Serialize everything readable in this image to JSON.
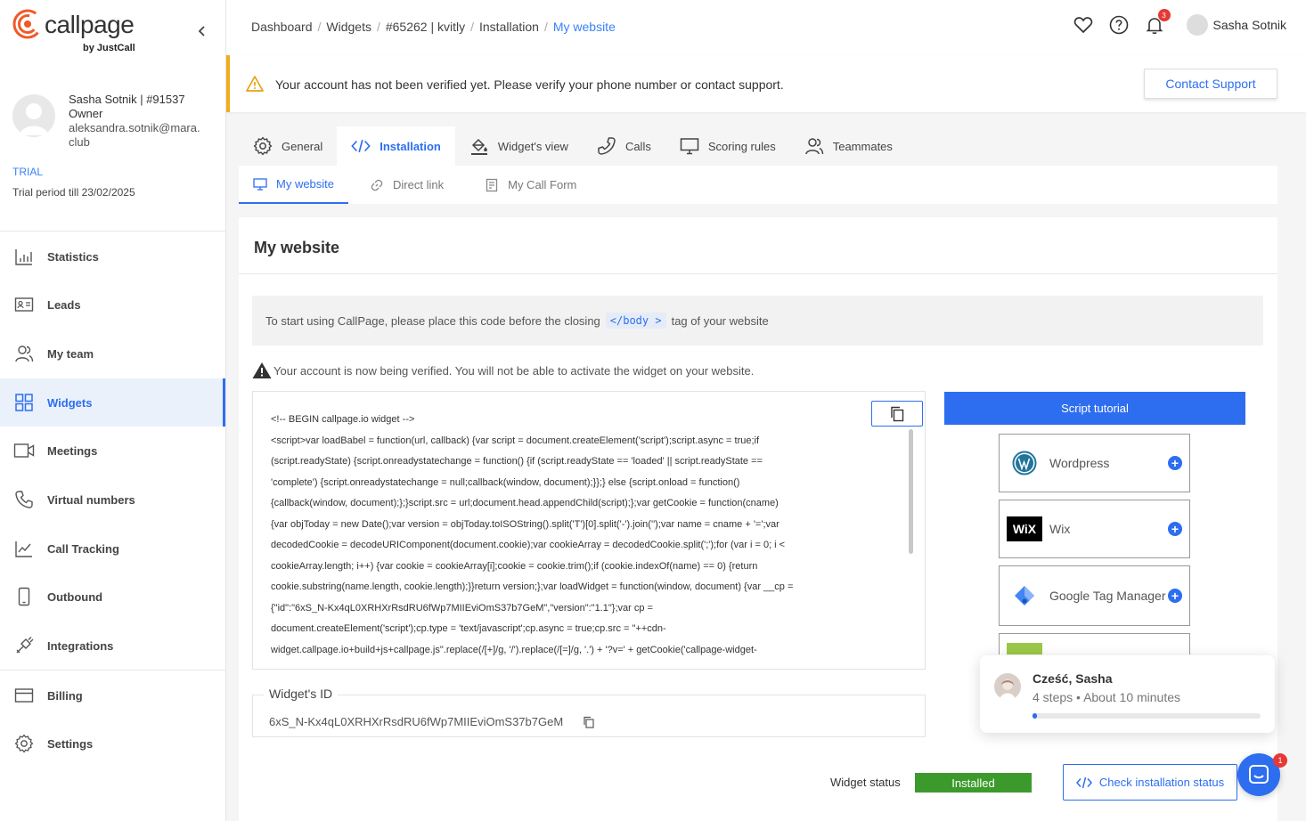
{
  "brand": {
    "name": "callpage",
    "tagline": "by JustCall",
    "accent": "#2d6ef0"
  },
  "profile": {
    "name": "Sasha Sotnik | #91537",
    "role": "Owner",
    "email": "aleksandra.sotnik@mara.club",
    "plan": "TRIAL",
    "trial": "Trial period till 23/02/2025"
  },
  "nav": [
    {
      "label": "Statistics",
      "icon": "bar-chart-icon"
    },
    {
      "label": "Leads",
      "icon": "id-card-icon"
    },
    {
      "label": "My team",
      "icon": "team-icon"
    },
    {
      "label": "Widgets",
      "icon": "grid-icon",
      "active": true
    },
    {
      "label": "Meetings",
      "icon": "video-icon"
    },
    {
      "label": "Virtual numbers",
      "icon": "phone-icon"
    },
    {
      "label": "Call Tracking",
      "icon": "trend-icon"
    },
    {
      "label": "Outbound",
      "icon": "mobile-icon"
    },
    {
      "label": "Integrations",
      "icon": "plug-icon"
    },
    {
      "label": "Billing",
      "icon": "card-icon"
    },
    {
      "label": "Settings",
      "icon": "gear-icon"
    }
  ],
  "breadcrumb": [
    "Dashboard",
    "Widgets",
    "#65262 | kvitly",
    "Installation",
    "My website"
  ],
  "topbar": {
    "user": "Sasha Sotnik",
    "notifications": "3"
  },
  "banner": {
    "text": "Your account has not been verified yet. Please verify your phone number or contact support.",
    "button": "Contact Support"
  },
  "tabs": [
    {
      "label": "General",
      "icon": "gear-icon"
    },
    {
      "label": "Installation",
      "icon": "code-icon",
      "active": true
    },
    {
      "label": "Widget's view",
      "icon": "paint-bucket-icon"
    },
    {
      "label": "Calls",
      "icon": "phone-icon"
    },
    {
      "label": "Scoring rules",
      "icon": "monitor-icon"
    },
    {
      "label": "Teammates",
      "icon": "teammates-icon"
    }
  ],
  "subtabs": [
    {
      "label": "My website",
      "icon": "monitor-icon",
      "active": true
    },
    {
      "label": "Direct link",
      "icon": "link-icon"
    },
    {
      "label": "My Call Form",
      "icon": "form-icon"
    }
  ],
  "main": {
    "title": "My website",
    "info_before": "To start using CallPage, please place this code before the closing",
    "info_tag": "</body >",
    "info_after": "tag of your website",
    "verify_note": "Your account is now being verified. You will not be able to activate the widget on your website.",
    "code_lines": [
      "<!-- BEGIN callpage.io widget -->",
      "<script>var loadBabel = function(url, callback) {var script = document.createElement('script');script.async = true;if",
      "(script.readyState) {script.onreadystatechange = function() {if (script.readyState == 'loaded' || script.readyState ==",
      "'complete') {script.onreadystatechange = null;callback(window, document);}};} else {script.onload = function()",
      "{callback(window, document);};}script.src = url;document.head.appendChild(script);};var getCookie = function(cname)",
      "{var objToday = new Date();var version = objToday.toISOString().split('T')[0].split('-').join('');var name = cname + '=';var",
      "decodedCookie = decodeURIComponent(document.cookie);var cookieArray = decodedCookie.split(';');for (var i = 0; i <",
      "cookieArray.length; i++) {var cookie = cookieArray[i];cookie = cookie.trim();if (cookie.indexOf(name) == 0) {return",
      "cookie.substring(name.length, cookie.length);}}return version;};var loadWidget = function(window, document) {var __cp =",
      "{\"id\":\"6xS_N-Kx4qL0XRHXrRsdRU6fWp7MIIEviOmS37b7GeM\",\"version\":\"1.1\"};var cp =",
      "document.createElement('script');cp.type = 'text/javascript';cp.async = true;cp.src = \"++cdn-",
      "widget.callpage.io+build+js+callpage.js\".replace(/[+]/g, '/').replace(/[=]/g, '.') + '?v=' + getCookie('callpage-widget-"
    ],
    "widget_id_label": "Widget's ID",
    "widget_id": "6xS_N-Kx4qL0XRHXrRsdRU6fWp7MIIEviOmS37b7GeM",
    "tutorial_button": "Script tutorial",
    "integrations": [
      {
        "name": "Wordpress",
        "icon": "wordpress-icon"
      },
      {
        "name": "Wix",
        "icon": "wix-icon"
      },
      {
        "name": "Google Tag Manager",
        "icon": "google-tag-manager-icon"
      }
    ],
    "status_label": "Widget status",
    "status_value": "Installed",
    "status_color": "#3c9a2c",
    "check_button": "Check installation status"
  },
  "onboarding": {
    "title": "Cześć, Sasha",
    "steps": "4 steps",
    "duration": "About 10 minutes",
    "progress": 0.02
  },
  "chat": {
    "badge": "1"
  }
}
